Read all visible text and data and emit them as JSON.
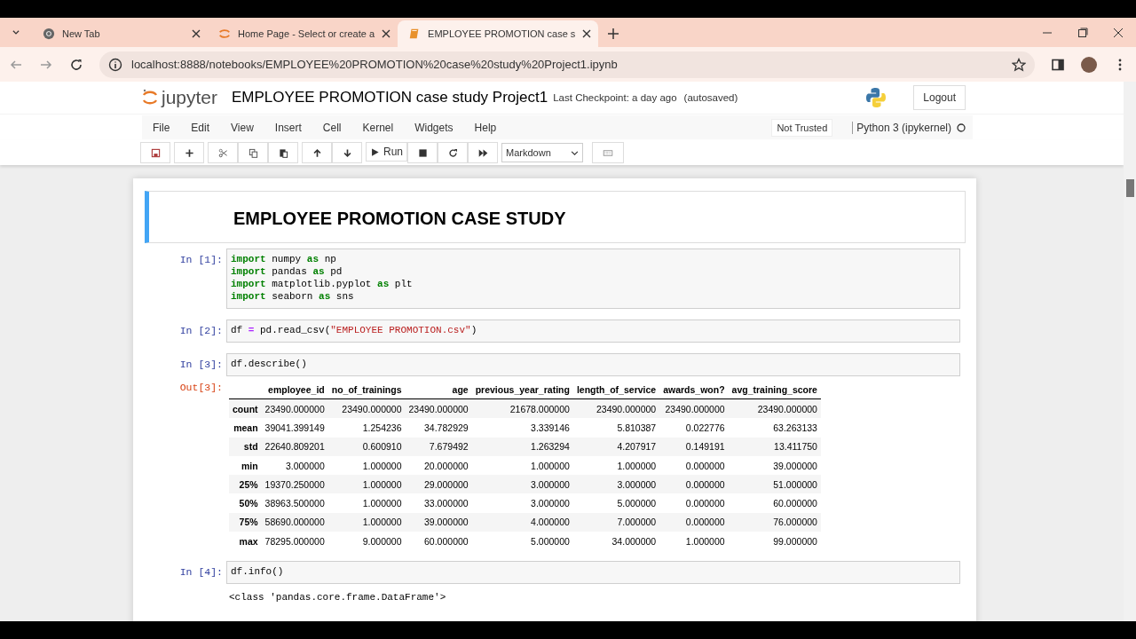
{
  "browser": {
    "tabs": [
      {
        "kind": "chrome",
        "title": "New Tab",
        "selected": false
      },
      {
        "kind": "spinner",
        "title": "Home Page - Select or create a",
        "selected": false
      },
      {
        "kind": "book",
        "title": "EMPLOYEE PROMOTION case s",
        "selected": true
      }
    ],
    "address": "localhost:8888/notebooks/EMPLOYEE%20PROMOTION%20case%20study%20Project1.ipynb"
  },
  "header": {
    "wordmark": "jupyter",
    "notebook_name": "EMPLOYEE PROMOTION case study Project1",
    "checkpoint": "Last Checkpoint: a day ago",
    "autosave": "(autosaved)",
    "logout": "Logout"
  },
  "menu": [
    "File",
    "Edit",
    "View",
    "Insert",
    "Cell",
    "Kernel",
    "Widgets",
    "Help"
  ],
  "trust": "Not Trusted",
  "kernel": "Python 3 (ipykernel)",
  "toolbar": {
    "run": "Run",
    "cell_type": "Markdown"
  },
  "cells": [
    {
      "kind": "markdown",
      "selected": true,
      "heading": "EMPLOYEE PROMOTION CASE STUDY"
    },
    {
      "kind": "code",
      "selected": false,
      "prompt": "In [1]:",
      "lines": [
        [
          {
            "kind": "keyword",
            "text": "import"
          },
          {
            "kind": "plain",
            "text": " numpy "
          },
          {
            "kind": "keyword",
            "text": "as"
          },
          {
            "kind": "plain",
            "text": " np"
          }
        ],
        [
          {
            "kind": "keyword",
            "text": "import"
          },
          {
            "kind": "plain",
            "text": " pandas "
          },
          {
            "kind": "keyword",
            "text": "as"
          },
          {
            "kind": "plain",
            "text": " pd"
          }
        ],
        [
          {
            "kind": "keyword",
            "text": "import"
          },
          {
            "kind": "plain",
            "text": " matplotlib.pyplot "
          },
          {
            "kind": "keyword",
            "text": "as"
          },
          {
            "kind": "plain",
            "text": " plt"
          }
        ],
        [
          {
            "kind": "keyword",
            "text": "import"
          },
          {
            "kind": "plain",
            "text": " seaborn "
          },
          {
            "kind": "keyword",
            "text": "as"
          },
          {
            "kind": "plain",
            "text": " sns"
          }
        ]
      ]
    },
    {
      "kind": "code",
      "selected": false,
      "prompt": "In [2]:",
      "lines": [
        [
          {
            "kind": "plain",
            "text": "df "
          },
          {
            "kind": "operator",
            "text": "="
          },
          {
            "kind": "plain",
            "text": " pd.read_csv("
          },
          {
            "kind": "string",
            "text": "\"EMPLOYEE PROMOTION.csv\""
          },
          {
            "kind": "plain",
            "text": ")"
          }
        ]
      ]
    },
    {
      "kind": "code",
      "selected": false,
      "prompt": "In [3]:",
      "lines": [
        [
          {
            "kind": "plain",
            "text": "df.describe()"
          }
        ]
      ],
      "output": {
        "prompt": "Out[3]:",
        "table": {
          "columns": [
            "employee_id",
            "no_of_trainings",
            "age",
            "previous_year_rating",
            "length_of_service",
            "awards_won?",
            "avg_training_score"
          ],
          "rows": [
            {
              "label": "count",
              "cells": [
                "23490.000000",
                "23490.000000",
                "23490.000000",
                "21678.000000",
                "23490.000000",
                "23490.000000",
                "23490.000000"
              ]
            },
            {
              "label": "mean",
              "cells": [
                "39041.399149",
                "1.254236",
                "34.782929",
                "3.339146",
                "5.810387",
                "0.022776",
                "63.263133"
              ]
            },
            {
              "label": "std",
              "cells": [
                "22640.809201",
                "0.600910",
                "7.679492",
                "1.263294",
                "4.207917",
                "0.149191",
                "13.411750"
              ]
            },
            {
              "label": "min",
              "cells": [
                "3.000000",
                "1.000000",
                "20.000000",
                "1.000000",
                "1.000000",
                "0.000000",
                "39.000000"
              ]
            },
            {
              "label": "25%",
              "cells": [
                "19370.250000",
                "1.000000",
                "29.000000",
                "3.000000",
                "3.000000",
                "0.000000",
                "51.000000"
              ]
            },
            {
              "label": "50%",
              "cells": [
                "38963.500000",
                "1.000000",
                "33.000000",
                "3.000000",
                "5.000000",
                "0.000000",
                "60.000000"
              ]
            },
            {
              "label": "75%",
              "cells": [
                "58690.000000",
                "1.000000",
                "39.000000",
                "4.000000",
                "7.000000",
                "0.000000",
                "76.000000"
              ]
            },
            {
              "label": "max",
              "cells": [
                "78295.000000",
                "9.000000",
                "60.000000",
                "5.000000",
                "34.000000",
                "1.000000",
                "99.000000"
              ]
            }
          ]
        }
      }
    },
    {
      "kind": "code",
      "selected": false,
      "prompt": "In [4]:",
      "lines": [
        [
          {
            "kind": "plain",
            "text": "df.info()"
          }
        ]
      ],
      "output": {
        "text": "<class 'pandas.core.frame.DataFrame'>"
      }
    }
  ]
}
